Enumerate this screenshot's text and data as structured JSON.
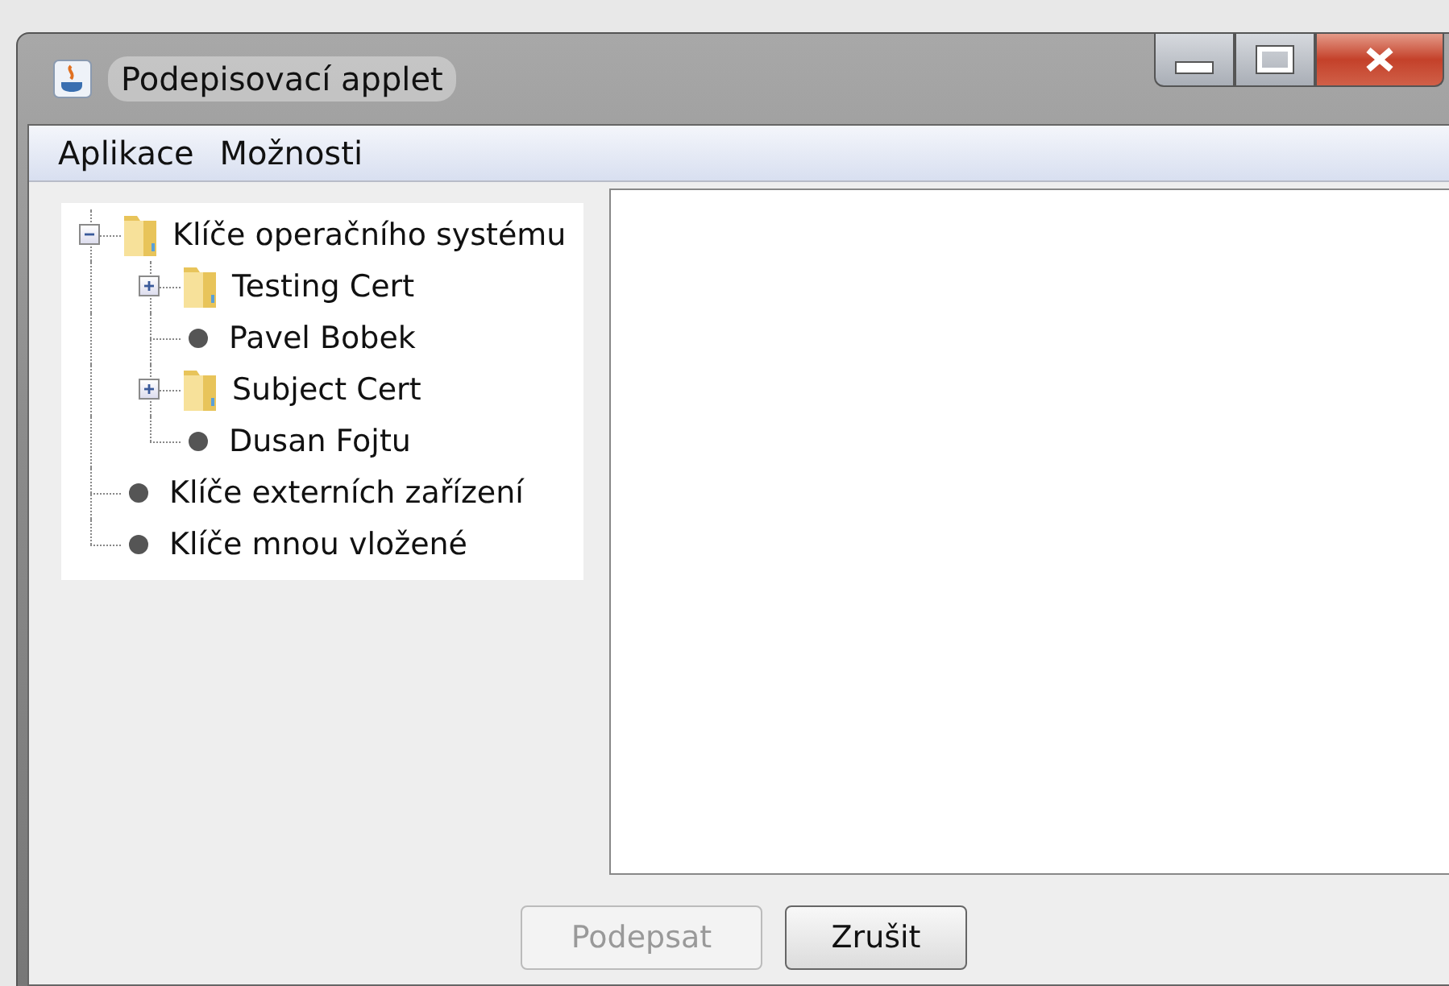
{
  "window": {
    "title": "Podepisovací applet"
  },
  "menu": [
    "Aplikace",
    "Možnosti"
  ],
  "tree": [
    {
      "label": "Klíče operačního systému",
      "kind": "folder",
      "expanded": true,
      "children": [
        {
          "label": "Testing Cert",
          "kind": "folder",
          "expanded": false
        },
        {
          "label": "Pavel Bobek",
          "kind": "leaf"
        },
        {
          "label": "Subject Cert",
          "kind": "folder",
          "expanded": false
        },
        {
          "label": "Dusan Fojtu",
          "kind": "leaf"
        }
      ]
    },
    {
      "label": "Klíče externích zařízení",
      "kind": "leaf"
    },
    {
      "label": "Klíče mnou vložené",
      "kind": "leaf"
    }
  ],
  "buttons": [
    {
      "label": "Podepsat",
      "disabled": true
    },
    {
      "label": "Zrušit",
      "disabled": false
    }
  ]
}
